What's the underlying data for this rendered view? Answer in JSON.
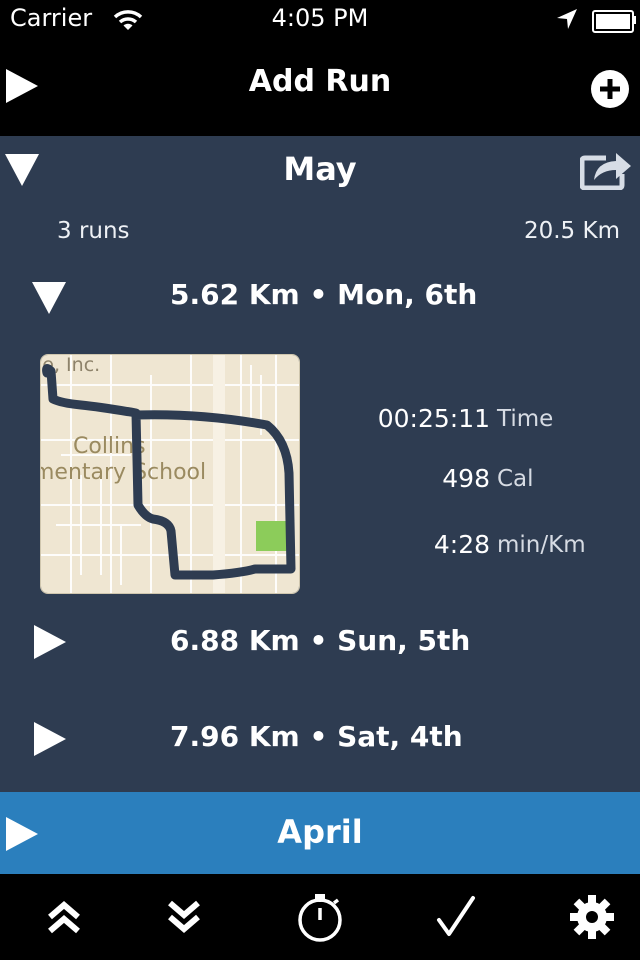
{
  "status_bar": {
    "carrier": "Carrier",
    "time": "4:05 PM"
  },
  "header": {
    "title": "Add Run"
  },
  "months": [
    {
      "name": "May",
      "run_count": "3 runs",
      "total_distance": "20.5 Km",
      "runs": [
        {
          "title": "5.62 Km • Mon, 6th",
          "expanded": true,
          "map": {
            "label_1": "le, Inc.",
            "label_2": "Collins",
            "label_3": "mentary School"
          },
          "stats": {
            "time_value": "00:25:11",
            "time_unit": "Time",
            "cal_value": "498",
            "cal_unit": "Cal",
            "pace_value": "4:28",
            "pace_unit": "min/Km"
          }
        },
        {
          "title": "6.88 Km • Sun, 5th",
          "expanded": false
        },
        {
          "title": "7.96 Km • Sat, 4th",
          "expanded": false
        }
      ]
    },
    {
      "name": "April"
    }
  ],
  "tabbar": {
    "icons": [
      "double-chevron-up-icon",
      "double-chevron-down-icon",
      "stopwatch-icon",
      "checkmark-icon",
      "gear-icon"
    ]
  },
  "colors": {
    "section_bg": "#2e3c51",
    "april_bg": "#2b7fbd",
    "bar_bg": "#000000"
  }
}
